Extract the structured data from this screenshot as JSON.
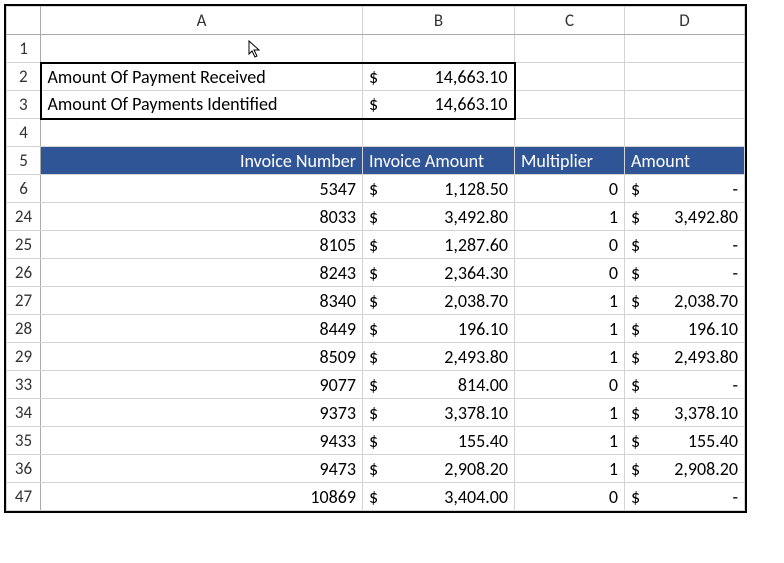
{
  "columns": [
    "A",
    "B",
    "C",
    "D"
  ],
  "summary": {
    "rows": [
      {
        "num": "2",
        "label": "Amount Of Payment Received",
        "value": "14,663.10"
      },
      {
        "num": "3",
        "label": "Amount Of Payments Identified",
        "value": "14,663.10"
      }
    ]
  },
  "header_row_num": "5",
  "headers": {
    "a": "Invoice Number",
    "b": "Invoice Amount",
    "c": "Multiplier",
    "d": "Amount"
  },
  "blank_row_nums": [
    "1",
    "4"
  ],
  "first_data_row_num": "6",
  "rows": [
    {
      "num": "6",
      "inv": "5347",
      "amt": "1,128.50",
      "mult": "0",
      "out": "-"
    },
    {
      "num": "24",
      "inv": "8033",
      "amt": "3,492.80",
      "mult": "1",
      "out": "3,492.80"
    },
    {
      "num": "25",
      "inv": "8105",
      "amt": "1,287.60",
      "mult": "0",
      "out": "-"
    },
    {
      "num": "26",
      "inv": "8243",
      "amt": "2,364.30",
      "mult": "0",
      "out": "-"
    },
    {
      "num": "27",
      "inv": "8340",
      "amt": "2,038.70",
      "mult": "1",
      "out": "2,038.70"
    },
    {
      "num": "28",
      "inv": "8449",
      "amt": "196.10",
      "mult": "1",
      "out": "196.10"
    },
    {
      "num": "29",
      "inv": "8509",
      "amt": "2,493.80",
      "mult": "1",
      "out": "2,493.80"
    },
    {
      "num": "33",
      "inv": "9077",
      "amt": "814.00",
      "mult": "0",
      "out": "-"
    },
    {
      "num": "34",
      "inv": "9373",
      "amt": "3,378.10",
      "mult": "1",
      "out": "3,378.10"
    },
    {
      "num": "35",
      "inv": "9433",
      "amt": "155.40",
      "mult": "1",
      "out": "155.40"
    },
    {
      "num": "36",
      "inv": "9473",
      "amt": "2,908.20",
      "mult": "1",
      "out": "2,908.20"
    },
    {
      "num": "47",
      "inv": "10869",
      "amt": "3,404.00",
      "mult": "0",
      "out": "-"
    }
  ],
  "currency_symbol": "$",
  "chart_data": {
    "type": "table",
    "title": "Invoice payment identification",
    "summary": [
      {
        "label": "Amount Of Payment Received",
        "value": 14663.1
      },
      {
        "label": "Amount Of Payments Identified",
        "value": 14663.1
      }
    ],
    "columns": [
      "Invoice Number",
      "Invoice Amount",
      "Multiplier",
      "Amount"
    ],
    "rows": [
      [
        5347,
        1128.5,
        0,
        0.0
      ],
      [
        8033,
        3492.8,
        1,
        3492.8
      ],
      [
        8105,
        1287.6,
        0,
        0.0
      ],
      [
        8243,
        2364.3,
        0,
        0.0
      ],
      [
        8340,
        2038.7,
        1,
        2038.7
      ],
      [
        8449,
        196.1,
        1,
        196.1
      ],
      [
        8509,
        2493.8,
        1,
        2493.8
      ],
      [
        9077,
        814.0,
        0,
        0.0
      ],
      [
        9373,
        3378.1,
        1,
        3378.1
      ],
      [
        9433,
        155.4,
        1,
        155.4
      ],
      [
        9473,
        2908.2,
        1,
        2908.2
      ],
      [
        10869,
        3404.0,
        0,
        0.0
      ]
    ]
  }
}
